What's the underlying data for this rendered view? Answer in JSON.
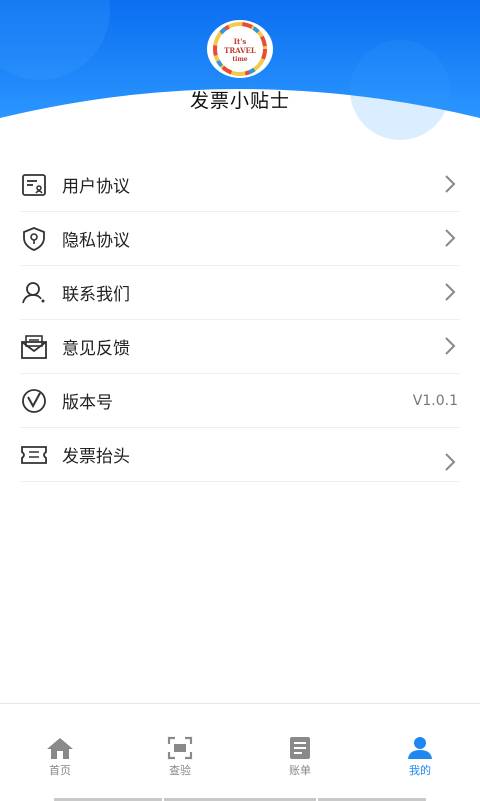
{
  "header": {
    "title": "发票小贴士",
    "logo_text": [
      "It's",
      "TRAVEL",
      "time"
    ],
    "colors": {
      "gradient_top": "#0a6ff0",
      "gradient_bottom": "#2f9bff"
    }
  },
  "menu": [
    {
      "id": "user-agreement",
      "label": "用户协议",
      "icon": "document-user-icon",
      "chevron": true
    },
    {
      "id": "privacy-agreement",
      "label": "隐私协议",
      "icon": "shield-lock-icon",
      "chevron": true
    },
    {
      "id": "contact-us",
      "label": "联系我们",
      "icon": "person-contact-icon",
      "chevron": true
    },
    {
      "id": "feedback",
      "label": "意见反馈",
      "icon": "mail-feedback-icon",
      "chevron": true
    },
    {
      "id": "version",
      "label": "版本号",
      "icon": "version-v-icon",
      "value": "V1.0.1"
    },
    {
      "id": "invoice-header",
      "label": "发票抬头",
      "icon": "ticket-icon",
      "chevron": true
    }
  ],
  "tabbar": {
    "tabs": [
      {
        "label": "首页",
        "icon": "home-icon",
        "active": false
      },
      {
        "label": "查验",
        "icon": "scan-icon",
        "active": false
      },
      {
        "label": "账单",
        "icon": "bill-icon",
        "active": false
      },
      {
        "label": "我的",
        "icon": "profile-icon",
        "active": true
      }
    ],
    "active_color": "#1e88f0",
    "inactive_color": "#8a8a8a"
  }
}
